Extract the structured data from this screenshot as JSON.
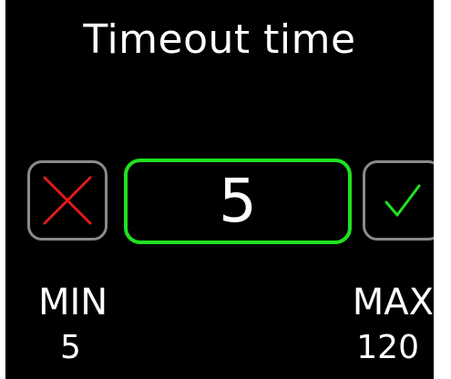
{
  "title": "Timeout time",
  "value": "5",
  "min": {
    "label": "MIN",
    "value": "5"
  },
  "max": {
    "label": "MAX",
    "value": "120"
  },
  "colors": {
    "background": "#000000",
    "accent": "#1fe21f",
    "cancel": "#e21a1a",
    "button_border": "#8a8a8a"
  },
  "icons": {
    "cancel": "close-x-icon",
    "confirm": "checkmark-icon"
  }
}
